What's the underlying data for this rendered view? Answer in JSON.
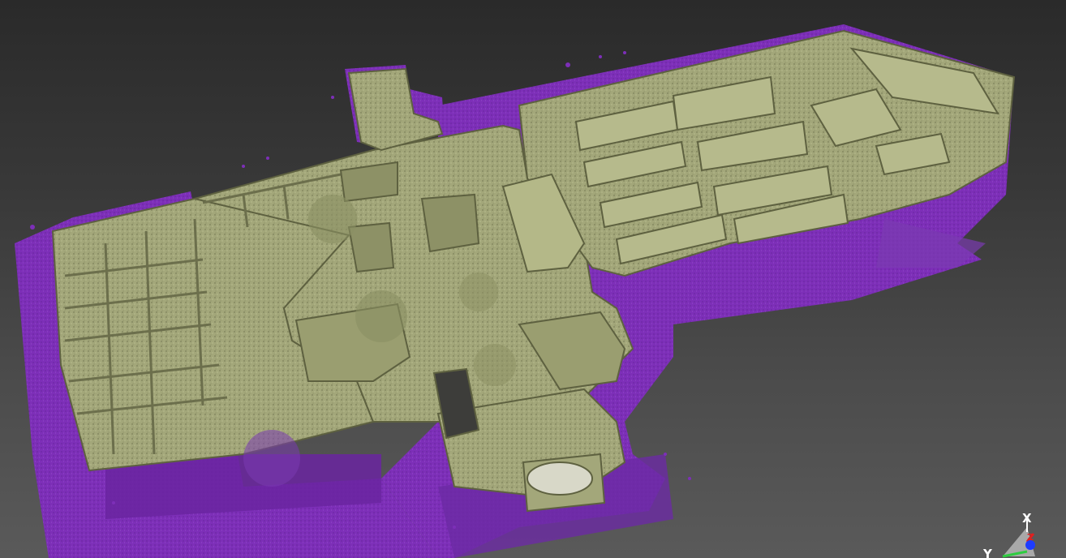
{
  "viewer": {
    "background_top": "#2a2a2a",
    "background_bottom": "#5a5a5a"
  },
  "point_cloud": {
    "floor_color": "#7d2fb8",
    "floor_shadow": "#5a1f8c",
    "model_color": "#a3a77a",
    "model_highlight": "#c4c79a",
    "model_shadow": "#6c6f4c"
  },
  "axis_gizmo": {
    "x_label": "X",
    "y_label": "Y",
    "z_label": "Z",
    "x_color": "#ffffff",
    "y_color": "#2ecc40",
    "z_color": "#e02020",
    "extra_color": "#1e3cff"
  }
}
